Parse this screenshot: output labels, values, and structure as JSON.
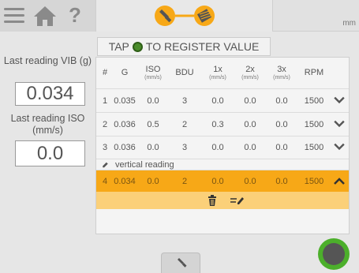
{
  "header": {
    "unit": "mm"
  },
  "left": {
    "vib_label": "Last reading VIB (g)",
    "vib_value": "0.034",
    "iso_label": "Last reading ISO (mm/s)",
    "iso_value": "0.0"
  },
  "banner": {
    "tap": "TAP",
    "text": "TO REGISTER VALUE"
  },
  "table": {
    "headers": {
      "num": "#",
      "g": "G",
      "iso": "ISO",
      "iso_unit": "(mm/s)",
      "bdu": "BDU",
      "x1": "1x",
      "x1_unit": "(mm/s)",
      "x2": "2x",
      "x2_unit": "(mm/s)",
      "x3": "3x",
      "x3_unit": "(mm/s)",
      "rpm": "RPM"
    },
    "rows": [
      {
        "num": "1",
        "g": "0.035",
        "iso": "0.0",
        "bdu": "3",
        "x1": "0.0",
        "x2": "0.0",
        "x3": "0.0",
        "rpm": "1500"
      },
      {
        "num": "2",
        "g": "0.036",
        "iso": "0.5",
        "bdu": "2",
        "x1": "0.3",
        "x2": "0.0",
        "x3": "0.0",
        "rpm": "1500"
      },
      {
        "num": "3",
        "g": "0.036",
        "iso": "0.0",
        "bdu": "3",
        "x1": "0.0",
        "x2": "0.0",
        "x3": "0.0",
        "rpm": "1500"
      },
      {
        "num": "4",
        "g": "0.034",
        "iso": "0.0",
        "bdu": "2",
        "x1": "0.0",
        "x2": "0.0",
        "x3": "0.0",
        "rpm": "1500"
      }
    ],
    "note": "vertical reading"
  },
  "colors": {
    "accent_orange": "#f7a817",
    "record_green": "#4caf2b"
  }
}
